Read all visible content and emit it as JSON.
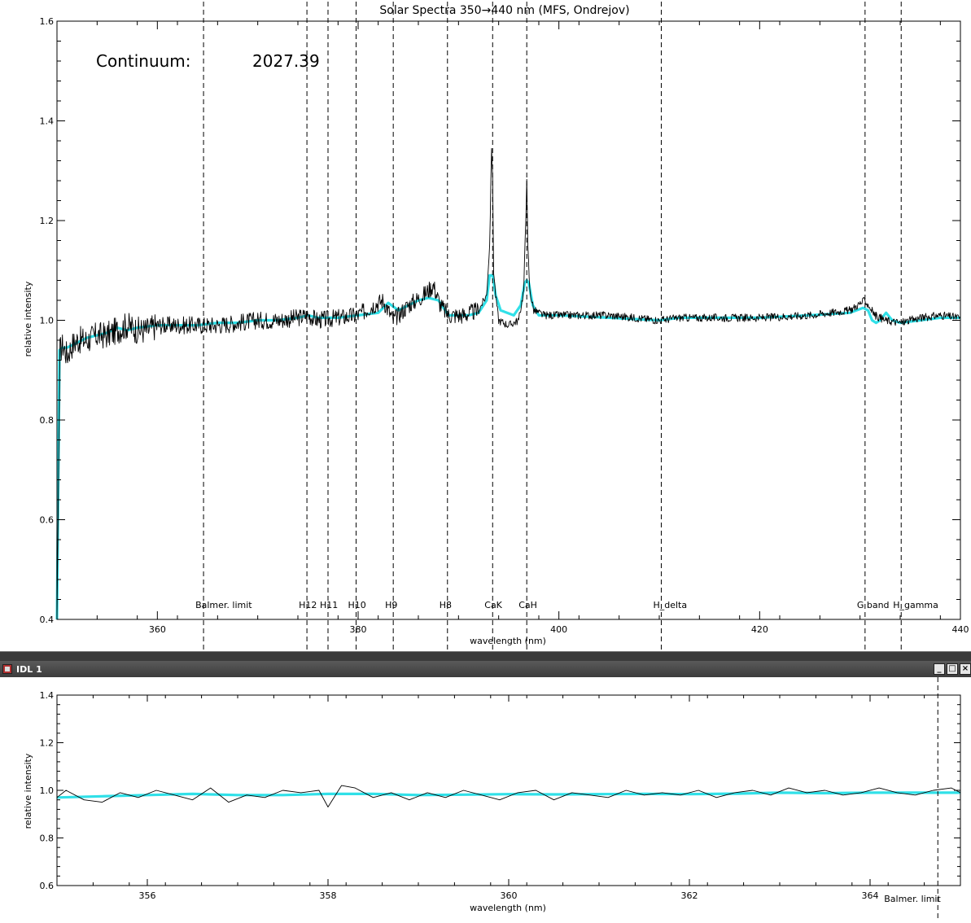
{
  "window": {
    "title": "IDL 1",
    "buttons": {
      "minimize": "_",
      "maximize": "□",
      "close": "×"
    }
  },
  "colors": {
    "spectrum": "#000000",
    "smooth": "#30e0e8",
    "axis": "#000000"
  },
  "chart_data": [
    {
      "type": "line",
      "title": "Solar Spectra 350→440 nm (MFS, Ondrejov)",
      "xlabel": "wavelength (nm)",
      "ylabel": "relative intensity",
      "xlim": [
        350,
        440
      ],
      "ylim": [
        0.4,
        1.6
      ],
      "xticks": [
        360,
        380,
        400,
        420,
        440
      ],
      "yticks": [
        0.4,
        0.6,
        0.8,
        1.0,
        1.2,
        1.4,
        1.6
      ],
      "annotation": {
        "label": "Continuum:",
        "value": "2027.39"
      },
      "reference_lines": [
        {
          "label": "Balmer. limit",
          "x": 364.6
        },
        {
          "label": "H12",
          "x": 374.9
        },
        {
          "label": "H11",
          "x": 377.0
        },
        {
          "label": "H10",
          "x": 379.8
        },
        {
          "label": "H9",
          "x": 383.5
        },
        {
          "label": "H8",
          "x": 388.9
        },
        {
          "label": "CaK",
          "x": 393.4
        },
        {
          "label": "CaH",
          "x": 396.8
        },
        {
          "label": "H_delta",
          "x": 410.2
        },
        {
          "label": "G band",
          "x": 430.5
        },
        {
          "label": "H_gamma",
          "x": 434.1
        }
      ],
      "series": [
        {
          "style": "thin-black",
          "x": [
            350.0,
            350.3,
            350.6,
            351.0,
            351.5,
            352.0,
            353.0,
            354.0,
            355.0,
            356.0,
            357.0,
            358.0,
            359.0,
            360.0,
            362.0,
            364.0,
            366.0,
            368.0,
            370.0,
            372.0,
            374.0,
            375.0,
            376.0,
            378.0,
            380.0,
            381.5,
            382.5,
            383.5,
            385.0,
            386.5,
            387.5,
            388.2,
            389.0,
            390.5,
            392.0,
            392.8,
            393.1,
            393.3,
            393.4,
            393.5,
            393.7,
            394.0,
            395.0,
            396.0,
            396.5,
            396.7,
            396.8,
            396.9,
            397.1,
            397.5,
            398.5,
            400.0,
            405.0,
            410.0,
            412.0,
            420.0,
            425.0,
            429.0,
            430.5,
            431.5,
            432.5,
            434.0,
            436.0,
            438.0,
            440.0
          ],
          "y": [
            0.4,
            0.94,
            0.95,
            0.93,
            0.95,
            0.96,
            0.96,
            0.97,
            0.97,
            0.98,
            0.99,
            0.98,
            0.98,
            0.99,
            0.99,
            0.99,
            0.99,
            0.995,
            1.0,
            1.0,
            1.005,
            1.01,
            1.0,
            1.005,
            1.01,
            1.03,
            1.04,
            1.0,
            1.03,
            1.05,
            1.07,
            1.03,
            1.01,
            1.01,
            1.02,
            1.05,
            1.15,
            1.35,
            1.28,
            1.1,
            1.05,
            1.0,
            0.99,
            1.0,
            1.06,
            1.2,
            1.29,
            1.15,
            1.06,
            1.02,
            1.01,
            1.01,
            1.01,
            1.0,
            1.005,
            1.005,
            1.01,
            1.02,
            1.04,
            1.01,
            1.0,
            0.995,
            1.005,
            1.01,
            1.005
          ]
        },
        {
          "style": "thick-cyan",
          "x": [
            350.0,
            350.25,
            350.5,
            351.0,
            351.5,
            352.0,
            353.0,
            354.0,
            355.0,
            356.0,
            357.0,
            358.0,
            360.0,
            362.0,
            364.0,
            366.0,
            368.0,
            370.0,
            372.0,
            374.0,
            375.0,
            376.0,
            378.0,
            380.0,
            382.0,
            383.0,
            384.0,
            386.0,
            387.0,
            388.0,
            389.0,
            391.0,
            392.0,
            392.8,
            393.1,
            393.4,
            393.7,
            394.2,
            395.5,
            396.2,
            396.6,
            396.8,
            397.0,
            397.4,
            398.0,
            400.0,
            405.0,
            410.0,
            412.0,
            420.0,
            425.0,
            429.0,
            430.3,
            430.8,
            431.2,
            431.6,
            432.0,
            432.6,
            433.2,
            434.0,
            436.0,
            438.0,
            440.0
          ],
          "y": [
            0.4,
            0.94,
            0.945,
            0.945,
            0.95,
            0.955,
            0.965,
            0.97,
            0.975,
            0.985,
            0.98,
            0.985,
            0.99,
            0.99,
            0.99,
            0.995,
            0.995,
            1.0,
            1.0,
            1.005,
            1.01,
            1.005,
            1.005,
            1.01,
            1.015,
            1.035,
            1.02,
            1.04,
            1.045,
            1.04,
            1.01,
            1.01,
            1.015,
            1.04,
            1.09,
            1.09,
            1.05,
            1.02,
            1.01,
            1.03,
            1.075,
            1.08,
            1.075,
            1.03,
            1.01,
            1.01,
            1.005,
            1.0,
            1.005,
            1.005,
            1.01,
            1.015,
            1.025,
            1.02,
            1.0,
            0.995,
            1.0,
            1.015,
            1.0,
            0.995,
            1.0,
            1.005,
            1.005
          ]
        }
      ]
    },
    {
      "type": "line",
      "xlabel": "wavelength (nm)",
      "ylabel": "relative intensity",
      "xlim": [
        355,
        365
      ],
      "ylim": [
        0.6,
        1.4
      ],
      "xticks": [
        356,
        358,
        360,
        362,
        364
      ],
      "yticks": [
        0.6,
        0.8,
        1.0,
        1.2,
        1.4
      ],
      "reference_lines": [
        {
          "label": "Balmer. limit",
          "x": 364.75
        }
      ],
      "series": [
        {
          "style": "thin-black",
          "x": [
            355.0,
            355.1,
            355.3,
            355.5,
            355.7,
            355.9,
            356.1,
            356.3,
            356.5,
            356.7,
            356.9,
            357.1,
            357.3,
            357.5,
            357.7,
            357.9,
            358.0,
            358.15,
            358.3,
            358.5,
            358.7,
            358.9,
            359.1,
            359.3,
            359.5,
            359.7,
            359.9,
            360.1,
            360.3,
            360.5,
            360.7,
            360.9,
            361.1,
            361.3,
            361.5,
            361.7,
            361.9,
            362.1,
            362.3,
            362.5,
            362.7,
            362.9,
            363.1,
            363.3,
            363.5,
            363.7,
            363.9,
            364.1,
            364.3,
            364.5,
            364.7,
            364.9,
            365.0
          ],
          "y": [
            0.97,
            1.0,
            0.96,
            0.95,
            0.99,
            0.97,
            1.0,
            0.98,
            0.96,
            1.01,
            0.95,
            0.98,
            0.97,
            1.0,
            0.99,
            1.0,
            0.93,
            1.02,
            1.01,
            0.97,
            0.99,
            0.96,
            0.99,
            0.97,
            1.0,
            0.98,
            0.96,
            0.99,
            1.0,
            0.96,
            0.99,
            0.98,
            0.97,
            1.0,
            0.98,
            0.99,
            0.98,
            1.0,
            0.97,
            0.99,
            1.0,
            0.98,
            1.01,
            0.99,
            1.0,
            0.98,
            0.99,
            1.01,
            0.99,
            0.98,
            1.0,
            1.01,
            0.99
          ]
        },
        {
          "style": "thick-cyan",
          "x": [
            355.0,
            355.5,
            356.0,
            356.5,
            357.0,
            357.5,
            358.0,
            358.5,
            359.0,
            359.5,
            360.0,
            360.5,
            361.0,
            361.5,
            362.0,
            362.5,
            363.0,
            363.5,
            364.0,
            364.5,
            365.0
          ],
          "y": [
            0.97,
            0.975,
            0.98,
            0.985,
            0.98,
            0.98,
            0.985,
            0.985,
            0.98,
            0.982,
            0.984,
            0.983,
            0.984,
            0.985,
            0.984,
            0.986,
            0.99,
            0.988,
            0.99,
            0.99,
            0.99
          ]
        }
      ]
    }
  ]
}
